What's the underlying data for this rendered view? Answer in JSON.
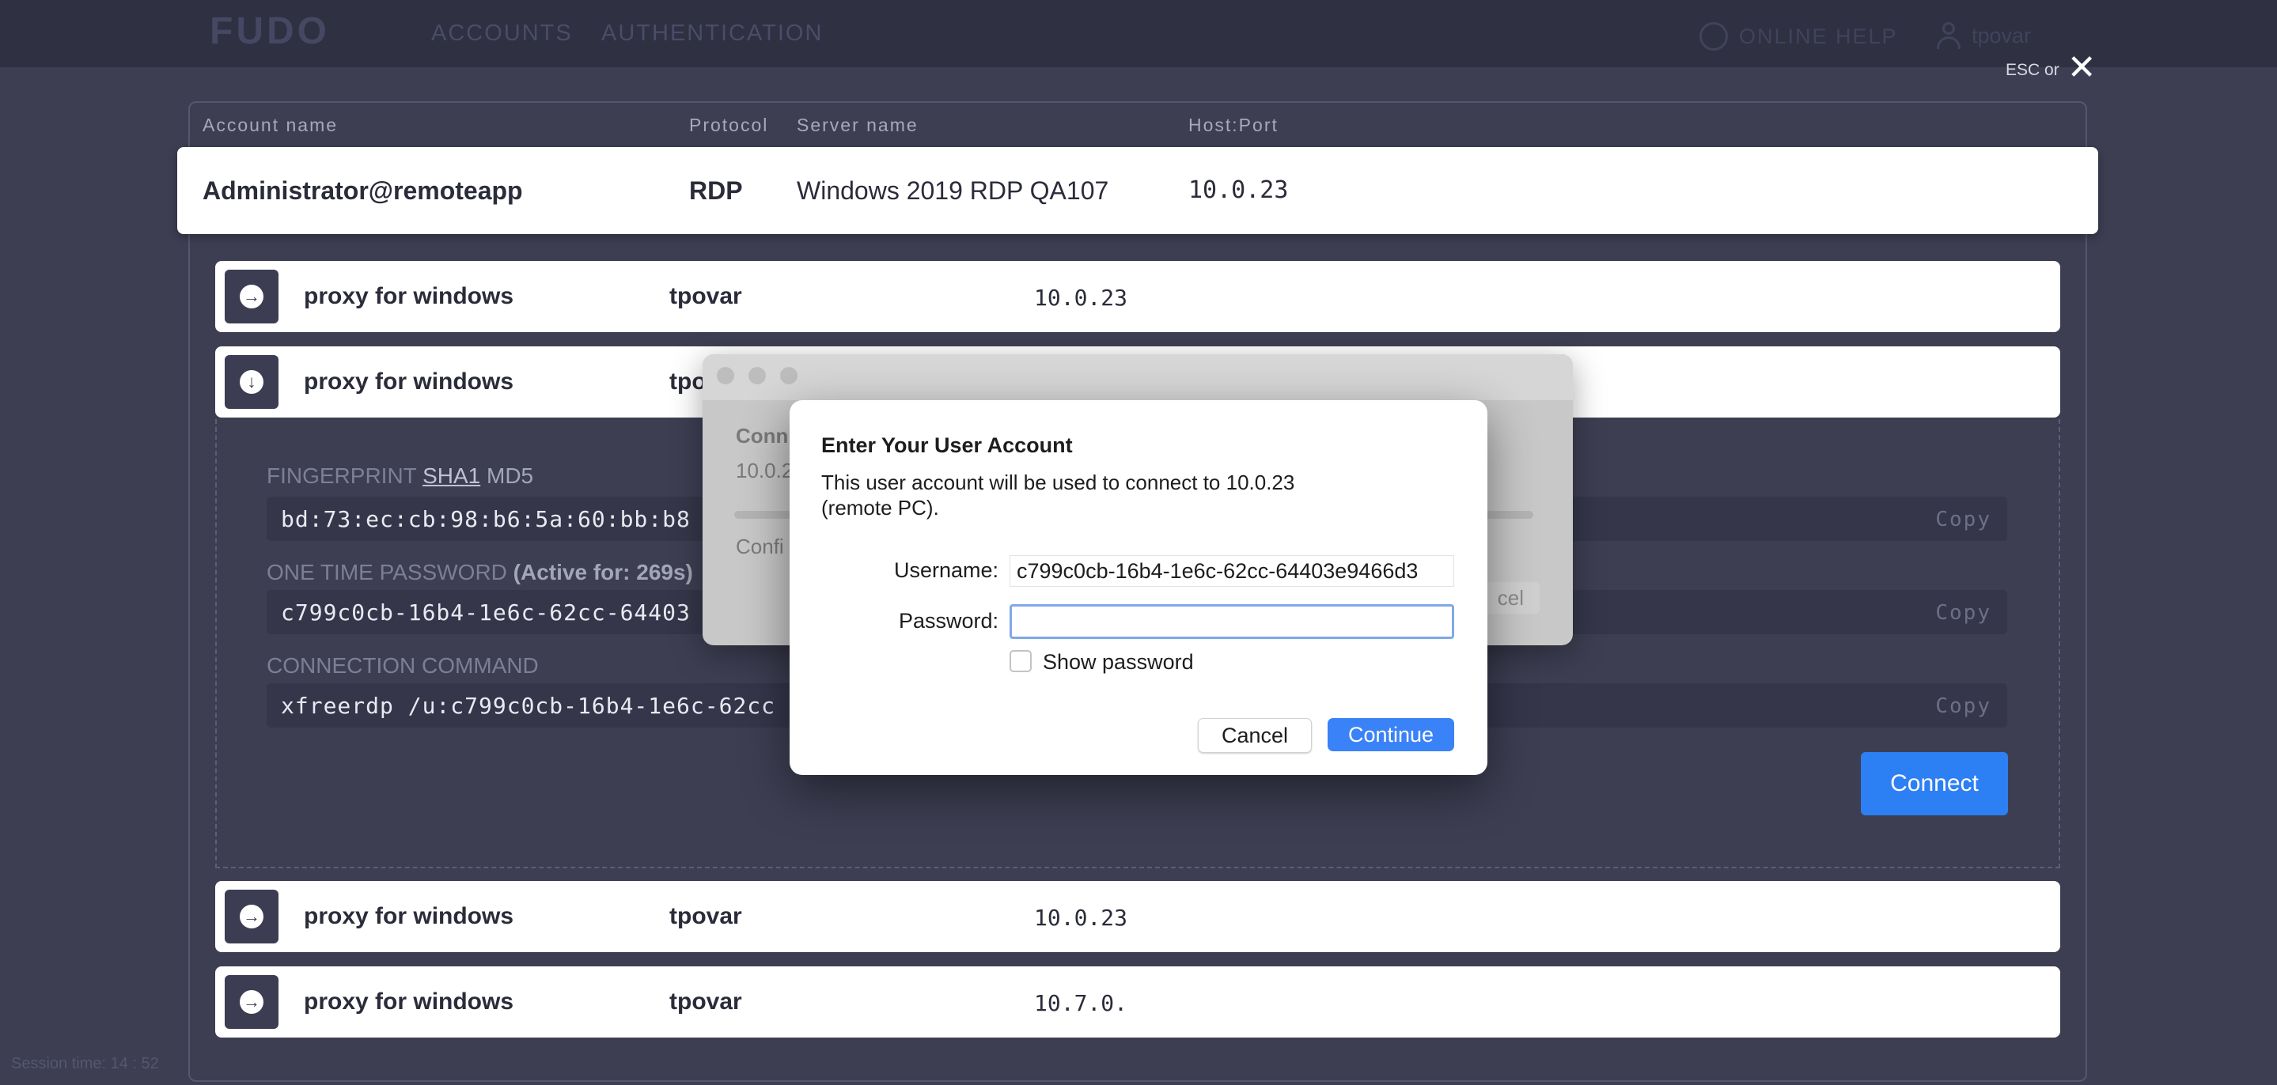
{
  "topbar": {
    "logo": "FUDO",
    "nav": [
      "ACCOUNTS",
      "AUTHENTICATION"
    ],
    "online_help": "ONLINE HELP",
    "user": "tpovar"
  },
  "close": {
    "label": "ESC or",
    "icon": "✕"
  },
  "table": {
    "headers": [
      "Account name",
      "Protocol",
      "Server name",
      "Host:Port"
    ],
    "selected": {
      "account": "Administrator@remoteapp",
      "protocol": "RDP",
      "server": "Windows 2019 RDP QA107",
      "host": "10.0.23"
    },
    "rows": [
      {
        "name": "proxy for windows",
        "user": "tpovar",
        "host": "10.0.23",
        "icon": "arrow-right-circle"
      },
      {
        "name": "proxy for windows",
        "user": "tpovar",
        "host": "",
        "icon": "arrow-down-circle"
      },
      {
        "name": "proxy for windows",
        "user": "tpovar",
        "host": "10.0.23",
        "icon": "arrow-right-circle"
      },
      {
        "name": "proxy for windows",
        "user": "tpovar",
        "host": "10.7.0.",
        "icon": "arrow-right-circle"
      }
    ]
  },
  "details": {
    "fingerprint_label": "FINGERPRINT",
    "sha1": "SHA1",
    "md5": "MD5",
    "fingerprint_value": "bd:73:ec:cb:98:b6:5a:60:bb:b8",
    "otp_label": "ONE TIME PASSWORD",
    "otp_active": "(Active for: 269s)",
    "otp_value": "c799c0cb-16b4-1e6c-62cc-64403",
    "cmd_label": "CONNECTION COMMAND",
    "cmd_value": "xfreerdp /u:c799c0cb-16b4-1e6c-62cc",
    "copy": "Copy",
    "connect": "Connect"
  },
  "session": "Session time: 14 : 52",
  "mac_window": {
    "line1": "Conn",
    "line2": "10.0.2",
    "line3": "Confi",
    "button": "cel"
  },
  "dialog": {
    "title": "Enter Your User Account",
    "message": "This user account will be used to connect to 10.0.23\n(remote PC).",
    "username_label": "Username:",
    "username_value": "c799c0cb-16b4-1e6c-62cc-64403e9466d3",
    "password_label": "Password:",
    "show_password": "Show password",
    "cancel": "Cancel",
    "continue": "Continue"
  }
}
